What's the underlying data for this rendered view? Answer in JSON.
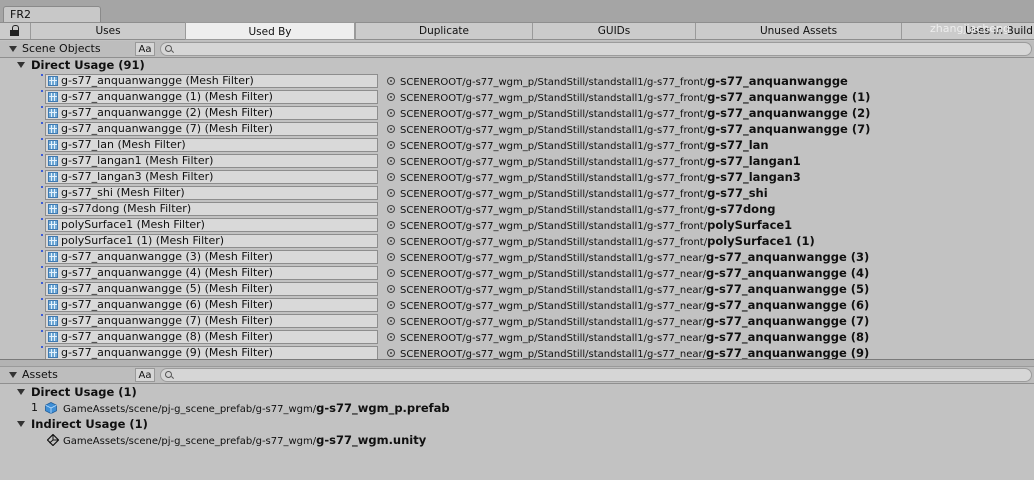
{
  "window": {
    "tab_title": "FR2",
    "watermark": "zhangjiacheng"
  },
  "tabs": [
    {
      "label": "Uses"
    },
    {
      "label": "Used By"
    },
    {
      "label": "Duplicate"
    },
    {
      "label": "GUIDs"
    },
    {
      "label": "Unused Assets"
    },
    {
      "label": "Uses In Build"
    }
  ],
  "scene_panel": {
    "title": "Scene Objects",
    "case_toggle": "Aa",
    "search_value": "",
    "group_title": "Direct Usage (91)",
    "path_prefix_front": "SCENEROOT/g-s77_wgm_p/StandStill/standstall1/g-s77_front/",
    "path_prefix_near": "SCENEROOT/g-s77_wgm_p/StandStill/standstall1/g-s77_near/",
    "rows": [
      {
        "object": "g-s77_anquanwangge (Mesh Filter)",
        "prefix": "SCENEROOT/g-s77_wgm_p/StandStill/standstall1/g-s77_front/",
        "name": "g-s77_anquanwangge"
      },
      {
        "object": "g-s77_anquanwangge (1) (Mesh Filter)",
        "prefix": "SCENEROOT/g-s77_wgm_p/StandStill/standstall1/g-s77_front/",
        "name": "g-s77_anquanwangge (1)"
      },
      {
        "object": "g-s77_anquanwangge (2) (Mesh Filter)",
        "prefix": "SCENEROOT/g-s77_wgm_p/StandStill/standstall1/g-s77_front/",
        "name": "g-s77_anquanwangge (2)"
      },
      {
        "object": "g-s77_anquanwangge (7) (Mesh Filter)",
        "prefix": "SCENEROOT/g-s77_wgm_p/StandStill/standstall1/g-s77_front/",
        "name": "g-s77_anquanwangge (7)"
      },
      {
        "object": "g-s77_lan (Mesh Filter)",
        "prefix": "SCENEROOT/g-s77_wgm_p/StandStill/standstall1/g-s77_front/",
        "name": "g-s77_lan"
      },
      {
        "object": "g-s77_langan1 (Mesh Filter)",
        "prefix": "SCENEROOT/g-s77_wgm_p/StandStill/standstall1/g-s77_front/",
        "name": "g-s77_langan1"
      },
      {
        "object": "g-s77_langan3 (Mesh Filter)",
        "prefix": "SCENEROOT/g-s77_wgm_p/StandStill/standstall1/g-s77_front/",
        "name": "g-s77_langan3"
      },
      {
        "object": "g-s77_shi (Mesh Filter)",
        "prefix": "SCENEROOT/g-s77_wgm_p/StandStill/standstall1/g-s77_front/",
        "name": "g-s77_shi"
      },
      {
        "object": "g-s77dong (Mesh Filter)",
        "prefix": "SCENEROOT/g-s77_wgm_p/StandStill/standstall1/g-s77_front/",
        "name": "g-s77dong"
      },
      {
        "object": "polySurface1 (Mesh Filter)",
        "prefix": "SCENEROOT/g-s77_wgm_p/StandStill/standstall1/g-s77_front/",
        "name": "polySurface1"
      },
      {
        "object": "polySurface1 (1) (Mesh Filter)",
        "prefix": "SCENEROOT/g-s77_wgm_p/StandStill/standstall1/g-s77_front/",
        "name": "polySurface1 (1)"
      },
      {
        "object": "g-s77_anquanwangge (3) (Mesh Filter)",
        "prefix": "SCENEROOT/g-s77_wgm_p/StandStill/standstall1/g-s77_near/",
        "name": "g-s77_anquanwangge (3)"
      },
      {
        "object": "g-s77_anquanwangge (4) (Mesh Filter)",
        "prefix": "SCENEROOT/g-s77_wgm_p/StandStill/standstall1/g-s77_near/",
        "name": "g-s77_anquanwangge (4)"
      },
      {
        "object": "g-s77_anquanwangge (5) (Mesh Filter)",
        "prefix": "SCENEROOT/g-s77_wgm_p/StandStill/standstall1/g-s77_near/",
        "name": "g-s77_anquanwangge (5)"
      },
      {
        "object": "g-s77_anquanwangge (6) (Mesh Filter)",
        "prefix": "SCENEROOT/g-s77_wgm_p/StandStill/standstall1/g-s77_near/",
        "name": "g-s77_anquanwangge (6)"
      },
      {
        "object": "g-s77_anquanwangge (7) (Mesh Filter)",
        "prefix": "SCENEROOT/g-s77_wgm_p/StandStill/standstall1/g-s77_near/",
        "name": "g-s77_anquanwangge (7)"
      },
      {
        "object": "g-s77_anquanwangge (8) (Mesh Filter)",
        "prefix": "SCENEROOT/g-s77_wgm_p/StandStill/standstall1/g-s77_near/",
        "name": "g-s77_anquanwangge (8)"
      },
      {
        "object": "g-s77_anquanwangge (9) (Mesh Filter)",
        "prefix": "SCENEROOT/g-s77_wgm_p/StandStill/standstall1/g-s77_near/",
        "name": "g-s77_anquanwangge (9)"
      }
    ]
  },
  "assets_panel": {
    "title": "Assets",
    "case_toggle": "Aa",
    "search_value": "",
    "direct": {
      "title": "Direct Usage (1)",
      "count": "1",
      "prefix": "GameAssets/scene/pj-g_scene_prefab/g-s77_wgm/",
      "name": "g-s77_wgm_p.prefab"
    },
    "indirect": {
      "title": "Indirect Usage (1)",
      "prefix": "GameAssets/scene/pj-g_scene_prefab/g-s77_wgm/",
      "name": "g-s77_wgm.unity"
    }
  },
  "colors": {
    "background": "#c2c2c2",
    "active_tab": "#eeeeee",
    "mesh_icon": "#6fa9d6",
    "prefab_icon": "#3f8fd6",
    "link_dot": "#3b5bd8"
  },
  "icons": [
    "lock-icon",
    "fold-arrow-icon",
    "search-icon",
    "mesh-filter-icon",
    "target-icon",
    "prefab-icon",
    "unity-scene-icon"
  ]
}
